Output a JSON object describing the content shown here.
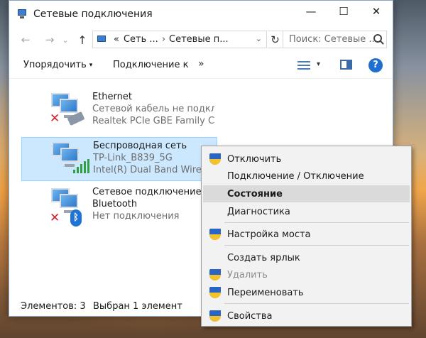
{
  "window": {
    "title": "Сетевые подключения",
    "controls": {
      "minimize": "—",
      "maximize": "☐",
      "close": "✕"
    }
  },
  "navigation": {
    "back": "←",
    "forward": "→",
    "recent": "⌄",
    "up": "↑"
  },
  "address": {
    "prefix": "«",
    "segments": [
      "Сеть ...",
      "Сетевые п..."
    ],
    "separator": "›",
    "dropdown": "⌄",
    "refresh": "↻"
  },
  "search": {
    "placeholder": "Поиск: Сетевые ..."
  },
  "commandbar": {
    "organize": "Упорядочить",
    "organize_caret": "▾",
    "connect_to": "Подключение к",
    "more": "»",
    "view_caret": "▾",
    "help": "?"
  },
  "connections": [
    {
      "name": "Ethernet",
      "status": "Сетевой кабель не подкл...",
      "device": "Realtek PCIe GBE Family Co...",
      "state_icon": "red-x-icon"
    },
    {
      "name": "Беспроводная сеть",
      "status": "TP-Link_B839_5G",
      "device": "Intel(R) Dual Band Wireles...",
      "state_icon": "signal-bars-icon"
    },
    {
      "name": "Сетевое подключение Bluetooth",
      "name_line1": "Сетевое подключение",
      "name_line2": "Bluetooth",
      "status": "Нет подключения",
      "state_icon": "red-x-icon"
    }
  ],
  "icons": {
    "red_x": "✕",
    "bluetooth": "ᛒ"
  },
  "statusbar": {
    "count": "Элементов: 3",
    "selection": "Выбран 1 элемент"
  },
  "context_menu": {
    "items": [
      {
        "label": "Отключить",
        "shield": true
      },
      {
        "label": "Подключение / Отключение",
        "shield": false
      },
      {
        "label": "Состояние",
        "shield": false,
        "bold": true,
        "hover": true
      },
      {
        "label": "Диагностика",
        "shield": false
      },
      {
        "label": "Настройка моста",
        "shield": true
      },
      {
        "label": "Создать ярлык",
        "shield": false
      },
      {
        "label": "Удалить",
        "shield": true,
        "disabled": true
      },
      {
        "label": "Переименовать",
        "shield": true
      },
      {
        "label": "Свойства",
        "shield": true
      }
    ]
  },
  "colors": {
    "selection_bg": "#cce8ff",
    "selection_border": "#99d1ff",
    "accent": "#1e6fd0",
    "error": "#d4202a",
    "signal": "#2ea043"
  }
}
